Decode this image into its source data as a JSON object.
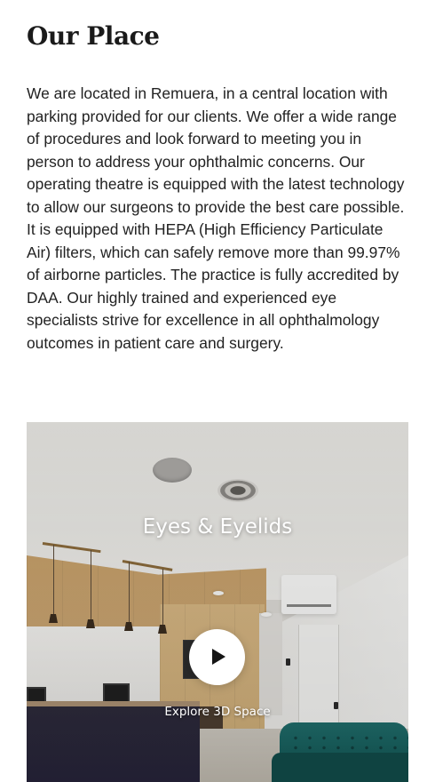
{
  "section": {
    "title": "Our Place",
    "body": "We are located in Remuera, in a central location with parking provided for our clients. We offer a wide range of procedures and look forward to meeting you in person to address your ophthalmic concerns. Our operating theatre is equipped with the latest technology to allow our surgeons to provide the best care possible. It is equipped with HEPA (High Efficiency Particulate Air) filters, which can safely remove more than 99.97% of airborne particles. The practice is fully accredited by DAA. Our highly trained and experienced eye specialists strive for excellence in all ophthalmology outcomes in patient care and surgery."
  },
  "tour": {
    "title": "Eyes & Eyelids",
    "play_icon": "play-icon",
    "explore_label": "Explore 3D Space"
  },
  "colors": {
    "heading": "#1a1a1a",
    "body_text": "#222222",
    "overlay_text": "#ffffff",
    "play_button_bg": "#ffffff",
    "play_icon": "#151515"
  }
}
